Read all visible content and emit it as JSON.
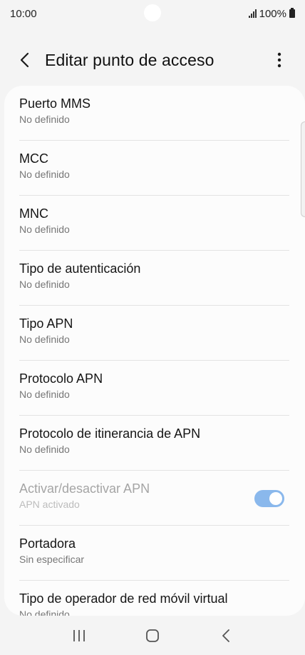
{
  "status_bar": {
    "time": "10:00",
    "battery": "100%"
  },
  "header": {
    "title": "Editar punto de acceso"
  },
  "items": [
    {
      "title": "Puerto MMS",
      "subtitle": "No definido"
    },
    {
      "title": "MCC",
      "subtitle": "No definido"
    },
    {
      "title": "MNC",
      "subtitle": "No definido"
    },
    {
      "title": "Tipo de autenticación",
      "subtitle": "No definido"
    },
    {
      "title": "Tipo APN",
      "subtitle": "No definido"
    },
    {
      "title": "Protocolo APN",
      "subtitle": "No definido"
    },
    {
      "title": "Protocolo de itinerancia de APN",
      "subtitle": "No definido"
    },
    {
      "title": "Activar/desactivar APN",
      "subtitle": "APN activado",
      "toggle_on": true,
      "disabled": true
    },
    {
      "title": "Portadora",
      "subtitle": "Sin especificar"
    },
    {
      "title": "Tipo de operador de red móvil virtual",
      "subtitle": "No definido"
    }
  ],
  "colors": {
    "toggle": "#8ab8ec",
    "background": "#f4f4f4",
    "card": "#fcfcfc"
  },
  "icons": [
    "back-icon",
    "more-vert-icon",
    "signal-icon",
    "battery-icon",
    "recents-icon",
    "home-icon",
    "nav-back-icon"
  ]
}
